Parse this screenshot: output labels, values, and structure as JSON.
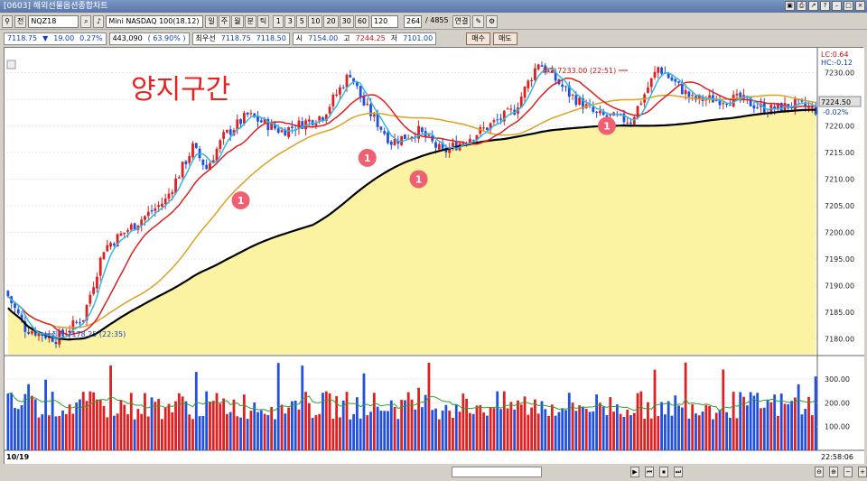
{
  "window": {
    "title": "[0603] 해외선물옵션종합차트",
    "buttons": [
      "▣",
      "⎙",
      "↗",
      "?",
      "–",
      "□",
      "×"
    ]
  },
  "toolbar": {
    "code": "NQZ18",
    "name": "Mini NASDAQ 100(18.12)",
    "periods": [
      "일",
      "주",
      "월",
      "분",
      "틱"
    ],
    "intervals": [
      "1",
      "3",
      "5",
      "10",
      "20",
      "30",
      "60"
    ],
    "count": "120",
    "visible": "264",
    "total": "/ 4855",
    "link": "연결",
    "prefix": "전"
  },
  "info": {
    "price": "7118.75",
    "dir": "▼",
    "change": "19.00",
    "pct": "0.27%",
    "volume": "443,090",
    "vol_ratio": "( 63.90% )",
    "pref_label": "최우선",
    "bid": "7118.75",
    "ask": "7118.50",
    "open_label": "시",
    "open": "7154.00",
    "high_label": "고",
    "high": "7244.25",
    "low_label": "저",
    "low": "7101.00",
    "buy": "매수",
    "sell": "매도"
  },
  "annotation": "양지구간",
  "marker_label": "1",
  "high_note": "최고 7233.00 (22:51)",
  "low_note": "최저 7178.25 (22:35)",
  "lc_label": "LC:0.64",
  "hc_label": "HC:-0.12",
  "price_tag": "7224.50",
  "pct_tag": "-0.02%",
  "date_label": "10/19",
  "time_label": "22:58:06",
  "colors": {
    "bull": "#e02020",
    "bear": "#2050e0",
    "fill": "#fbf3a2",
    "ma5": "#30b8e8",
    "ma20": "#e02020",
    "ma60": "#e0a020",
    "ma120": "#000000"
  },
  "chart_data": {
    "type": "candlestick",
    "price_axis": {
      "ylim": [
        7177,
        7234
      ],
      "ticks": [
        "7230.00",
        "7225.00",
        "7220.00",
        "7215.00",
        "7210.00",
        "7205.00",
        "7200.00",
        "7195.00",
        "7190.00",
        "7185.00",
        "7180.00"
      ]
    },
    "volume_axis": {
      "ylim": [
        0,
        380
      ],
      "ticks": [
        "300.00",
        "200.00",
        "100.00"
      ]
    },
    "close_path": [
      [
        0,
        7188
      ],
      [
        5,
        7182
      ],
      [
        14,
        7180
      ],
      [
        22,
        7184
      ],
      [
        28,
        7197
      ],
      [
        38,
        7202
      ],
      [
        46,
        7206
      ],
      [
        54,
        7216
      ],
      [
        58,
        7212
      ],
      [
        63,
        7218
      ],
      [
        70,
        7222
      ],
      [
        80,
        7219
      ],
      [
        92,
        7222
      ],
      [
        100,
        7230
      ],
      [
        104,
        7224
      ],
      [
        112,
        7217
      ],
      [
        120,
        7219
      ],
      [
        127,
        7215
      ],
      [
        138,
        7219
      ],
      [
        148,
        7223
      ],
      [
        155,
        7232
      ],
      [
        164,
        7226
      ],
      [
        172,
        7222
      ],
      [
        182,
        7221
      ],
      [
        190,
        7231
      ],
      [
        200,
        7225
      ],
      [
        214,
        7225
      ],
      [
        222,
        7223
      ],
      [
        230,
        7224
      ],
      [
        236,
        7223
      ]
    ],
    "markers": [
      [
        68,
        7206
      ],
      [
        105,
        7214
      ],
      [
        120,
        7210
      ],
      [
        175,
        7220
      ]
    ]
  }
}
